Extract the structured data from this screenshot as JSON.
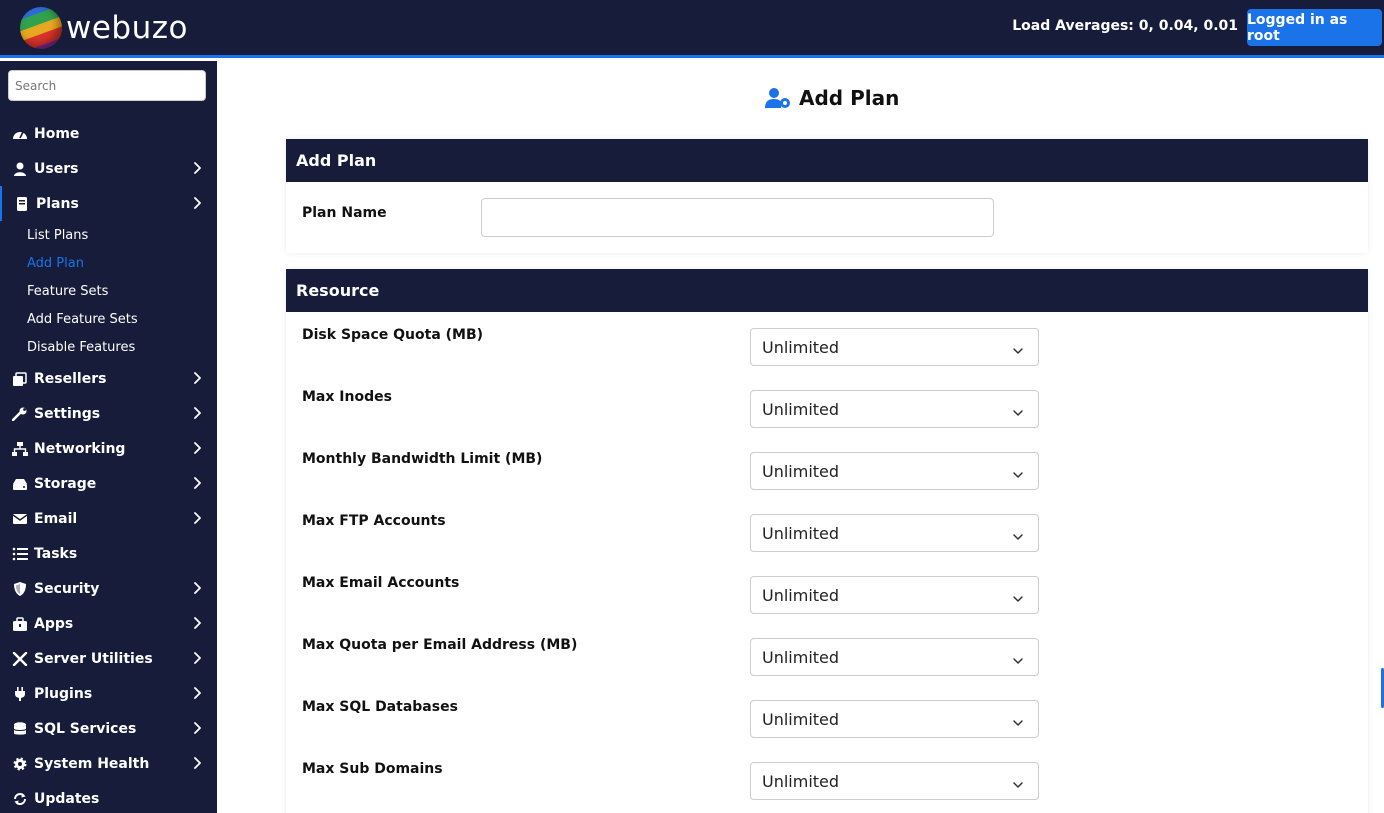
{
  "header": {
    "logo_text": "webuzo",
    "load_averages": "Load Averages: 0, 0.04, 0.01",
    "logged_in": "Logged in as root"
  },
  "sidebar": {
    "search_label": "Search",
    "items": [
      {
        "label": "Home",
        "icon": "dashboard-icon",
        "chevron": false
      },
      {
        "label": "Users",
        "icon": "user-icon",
        "chevron": true
      },
      {
        "label": "Plans",
        "icon": "plans-icon",
        "chevron": true,
        "active": true,
        "sub": [
          "List Plans",
          "Add Plan",
          "Feature Sets",
          "Add Feature Sets",
          "Disable Features"
        ],
        "current_sub": "Add Plan"
      },
      {
        "label": "Resellers",
        "icon": "resellers-icon",
        "chevron": true
      },
      {
        "label": "Settings",
        "icon": "wrench-icon",
        "chevron": true
      },
      {
        "label": "Networking",
        "icon": "network-icon",
        "chevron": true
      },
      {
        "label": "Storage",
        "icon": "storage-icon",
        "chevron": true
      },
      {
        "label": "Email",
        "icon": "envelope-icon",
        "chevron": true
      },
      {
        "label": "Tasks",
        "icon": "list-icon",
        "chevron": false
      },
      {
        "label": "Security",
        "icon": "shield-icon",
        "chevron": true
      },
      {
        "label": "Apps",
        "icon": "apps-icon",
        "chevron": true
      },
      {
        "label": "Server Utilities",
        "icon": "tools-icon",
        "chevron": true
      },
      {
        "label": "Plugins",
        "icon": "plug-icon",
        "chevron": true
      },
      {
        "label": "SQL Services",
        "icon": "database-icon",
        "chevron": true
      },
      {
        "label": "System Health",
        "icon": "gear-icon",
        "chevron": true
      },
      {
        "label": "Updates",
        "icon": "sync-icon",
        "chevron": false
      }
    ]
  },
  "main": {
    "page_title": "Add Plan",
    "add_plan_card": {
      "title": "Add Plan",
      "plan_name_label": "Plan Name",
      "plan_name_value": ""
    },
    "resource_card": {
      "title": "Resource",
      "rows": [
        {
          "label": "Disk Space Quota (MB)",
          "value": "Unlimited"
        },
        {
          "label": "Max Inodes",
          "value": "Unlimited"
        },
        {
          "label": "Monthly Bandwidth Limit (MB)",
          "value": "Unlimited"
        },
        {
          "label": "Max FTP Accounts",
          "value": "Unlimited"
        },
        {
          "label": "Max Email Accounts",
          "value": "Unlimited"
        },
        {
          "label": "Max Quota per Email Address (MB)",
          "value": "Unlimited"
        },
        {
          "label": "Max SQL Databases",
          "value": "Unlimited"
        },
        {
          "label": "Max Sub Domains",
          "value": "Unlimited"
        }
      ]
    }
  },
  "colors": {
    "navy": "#161c3a",
    "accent": "#1a73e8"
  }
}
